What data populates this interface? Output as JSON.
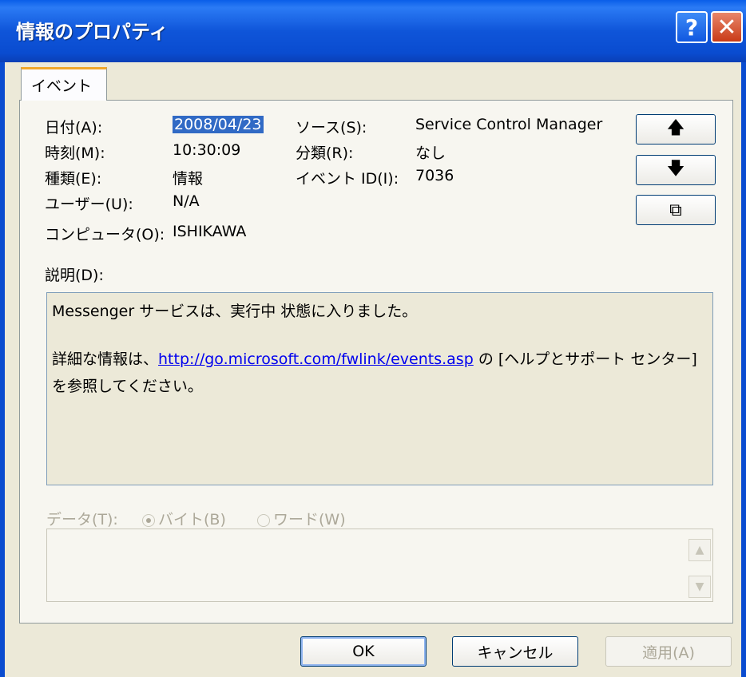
{
  "window": {
    "title": "情報のプロパティ",
    "help_glyph": "?",
    "close_glyph": "✕"
  },
  "tabs": [
    {
      "label": "イベント",
      "active": true
    }
  ],
  "fields": {
    "date_label": "日付(A):",
    "date_value": "2008/04/23",
    "time_label": "時刻(M):",
    "time_value": "10:30:09",
    "type_label": "種類(E):",
    "type_value": "情報",
    "user_label": "ユーザー(U):",
    "user_value": "N/A",
    "computer_label": "コンピュータ(O):",
    "computer_value": "ISHIKAWA",
    "source_label": "ソース(S):",
    "source_value": "Service Control Manager",
    "category_label": "分類(R):",
    "category_value": "なし",
    "eventid_label": "イベント ID(I):",
    "eventid_value": "7036"
  },
  "nav_buttons": {
    "up_icon": "up-arrow-icon",
    "up_glyph": "🡅",
    "down_icon": "down-arrow-icon",
    "down_glyph": "🡇",
    "copy_icon": "copy-icon",
    "copy_glyph": "⧉"
  },
  "description": {
    "label": "説明(D):",
    "line1": "Messenger サービスは、実行中 状態に入りました。",
    "line2_prefix": "詳細な情報は、",
    "link": "http://go.microsoft.com/fwlink/events.asp",
    "line2_suffix": " の [ヘルプとサポート センター] を参照してください。"
  },
  "data_section": {
    "label": "データ(T):",
    "radio_bytes": "バイト(B)",
    "radio_words": "ワード(W)",
    "selected": "バイト(B)"
  },
  "buttons": {
    "ok": "OK",
    "cancel": "キャンセル",
    "apply": "適用(A)"
  },
  "colors": {
    "titlebar": "#0a4cd0",
    "selection": "#316ac5",
    "link": "#0000ee",
    "tab_accent": "#f0a72a"
  }
}
